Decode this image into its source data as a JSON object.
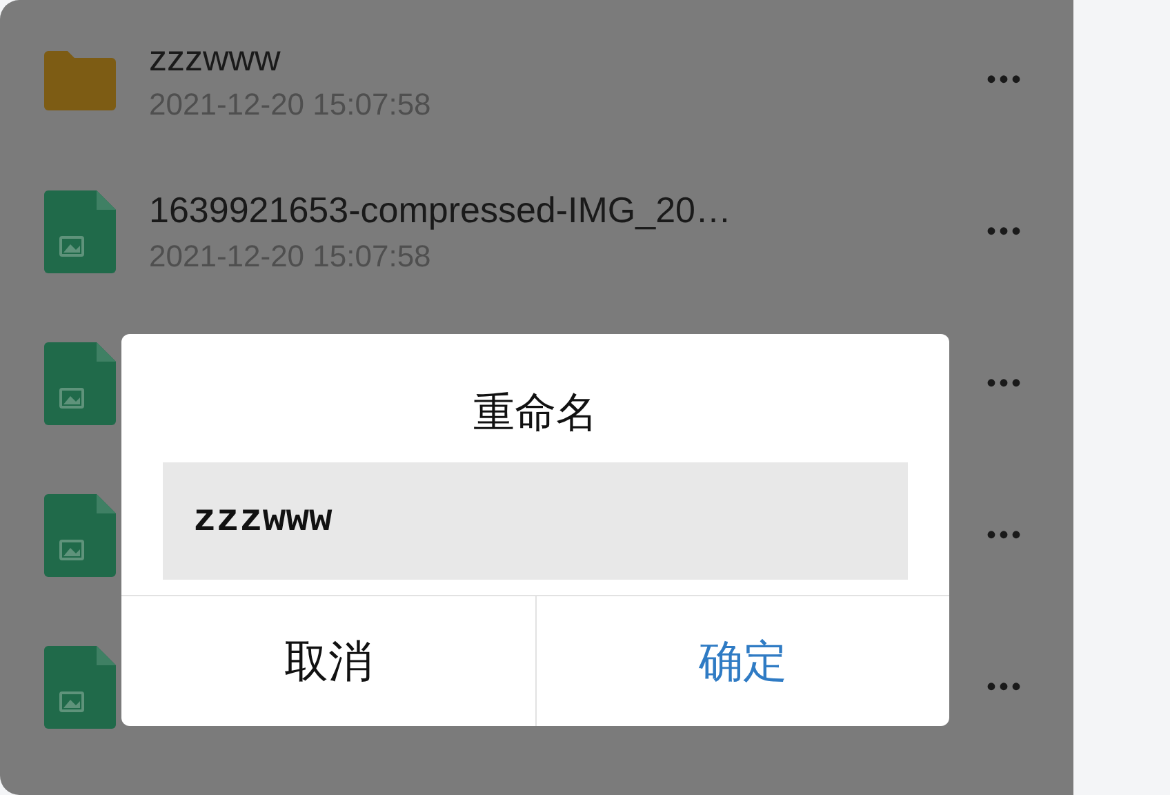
{
  "files": [
    {
      "kind": "folder",
      "name": "zzzwww",
      "date": "2021-12-20 15:07:58"
    },
    {
      "kind": "image",
      "name": "1639921653-compressed-IMG_20…",
      "date": "2021-12-20 15:07:58"
    },
    {
      "kind": "image"
    },
    {
      "kind": "image"
    },
    {
      "kind": "image"
    }
  ],
  "more_button": "•••",
  "dialog": {
    "title": "重命名",
    "input_value": "zzzwww",
    "buttons": [
      {
        "label": "取消",
        "kind": "cancel"
      },
      {
        "label": "确定",
        "kind": "confirm"
      }
    ]
  }
}
